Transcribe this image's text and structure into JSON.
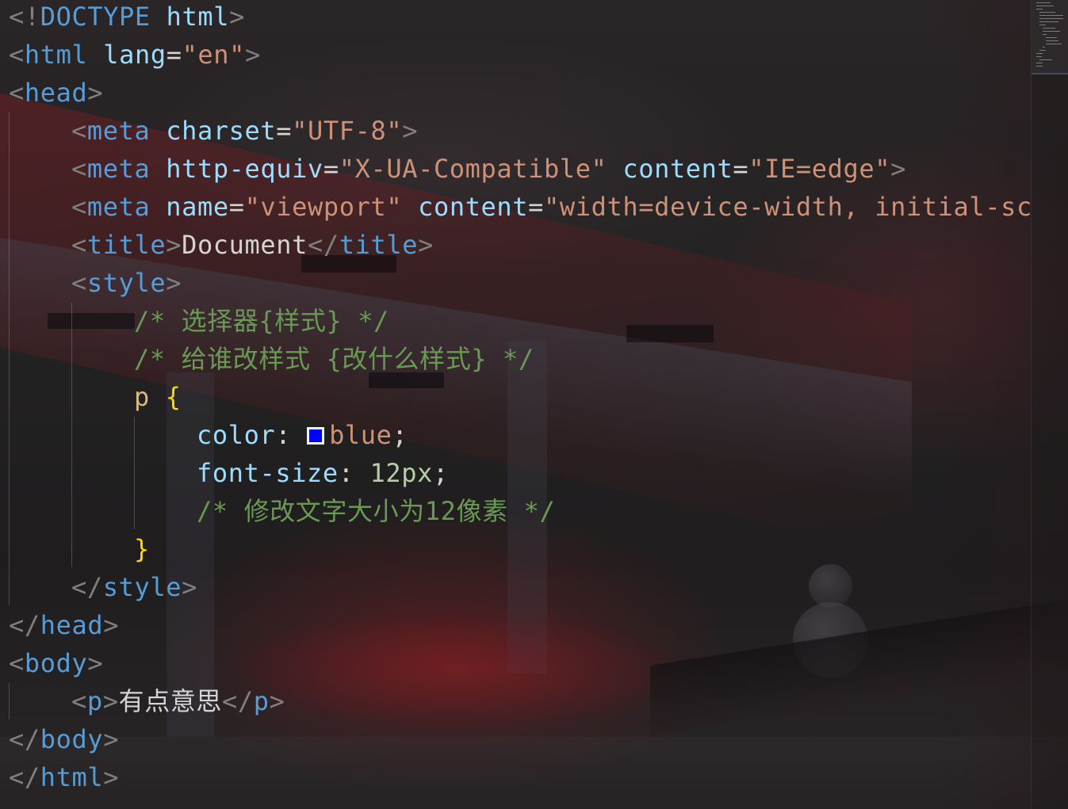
{
  "editor": {
    "language": "html",
    "colors": {
      "tag": "#569cd6",
      "attribute": "#9cdcfe",
      "string": "#ce9178",
      "comment": "#6a9955",
      "selector": "#d7ba7d",
      "brace": "#ffd700",
      "number": "#b5cea8",
      "swatch_blue": "#0000ff"
    },
    "code": {
      "doctype": {
        "open": "<!",
        "kw": "DOCTYPE",
        "name": "html",
        "close": ">"
      },
      "html_open": {
        "tag": "html",
        "attr": "lang",
        "value": "\"en\""
      },
      "head_open": {
        "tag": "head"
      },
      "meta_charset": {
        "tag": "meta",
        "attr": "charset",
        "value": "\"UTF-8\""
      },
      "meta_compat": {
        "tag": "meta",
        "attr1": "http-equiv",
        "value1": "\"X-UA-Compatible\"",
        "attr2": "content",
        "value2": "\"IE=edge\""
      },
      "meta_viewport": {
        "tag": "meta",
        "attr1": "name",
        "value1": "\"viewport\"",
        "attr2": "content",
        "value2": "\"width=device-width, initial-sc"
      },
      "title": {
        "tag": "title",
        "text": "Document"
      },
      "style_open": {
        "tag": "style"
      },
      "comment1": "/* 选择器{样式} */",
      "comment2": "/* 给谁改样式 {改什么样式} */",
      "rule": {
        "selector": "p",
        "open": "{",
        "close": "}",
        "color_prop": "color",
        "color_value": "blue",
        "fontsize_prop": "font-size",
        "fontsize_value": "12px",
        "comment": "/* 修改文字大小为12像素 */"
      },
      "style_close": {
        "tag": "style"
      },
      "head_close": {
        "tag": "head"
      },
      "body_open": {
        "tag": "body"
      },
      "p_element": {
        "tag": "p",
        "text": "有点意思"
      },
      "body_close": {
        "tag": "body"
      },
      "html_close": {
        "tag": "html"
      }
    }
  }
}
